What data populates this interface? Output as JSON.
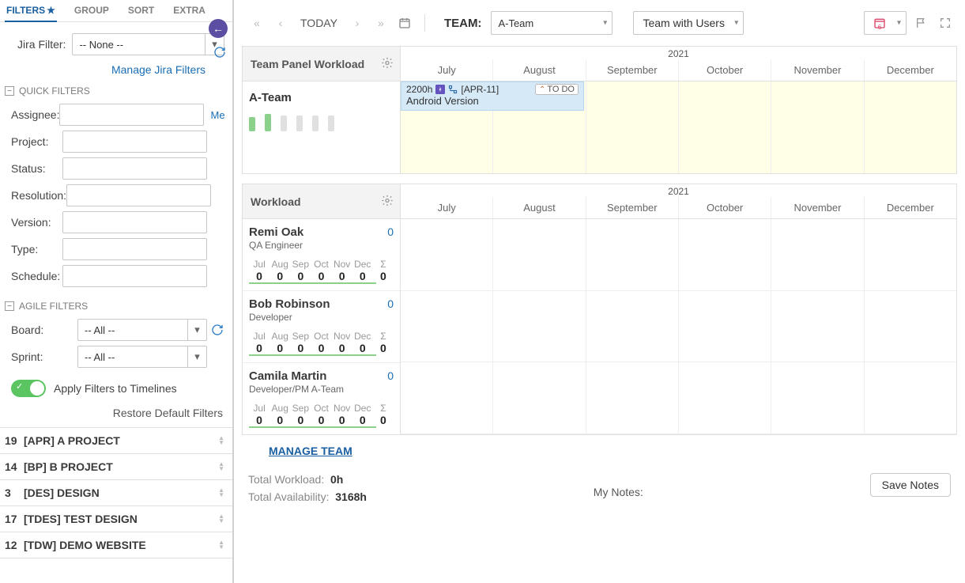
{
  "tabs": {
    "filters": "FILTERS",
    "group": "GROUP",
    "sort": "SORT",
    "extra": "EXTRA"
  },
  "sidebar": {
    "jira_label": "Jira Filter:",
    "jira_value": "-- None --",
    "manage_link": "Manage Jira Filters",
    "quick_filters_title": "QUICK FILTERS",
    "filters": {
      "assignee": "Assignee:",
      "project": "Project:",
      "status": "Status:",
      "resolution": "Resolution:",
      "version": "Version:",
      "type": "Type:",
      "schedule": "Schedule:"
    },
    "me": "Me",
    "agile_title": "AGILE FILTERS",
    "board_label": "Board:",
    "board_value": "-- All --",
    "sprint_label": "Sprint:",
    "sprint_value": "-- All --",
    "apply_label": "Apply Filters to Timelines",
    "restore_label": "Restore Default Filters",
    "projects": [
      {
        "count": "19",
        "name": "[APR] A PROJECT"
      },
      {
        "count": "14",
        "name": "[BP] B PROJECT"
      },
      {
        "count": "3",
        "name": "[DES] DESIGN"
      },
      {
        "count": "17",
        "name": "[TDES] TEST DESIGN"
      },
      {
        "count": "12",
        "name": "[TDW] DEMO WEBSITE"
      }
    ]
  },
  "toolbar": {
    "today": "TODAY",
    "team_label": "TEAM:",
    "team_value": "A-Team",
    "mode_value": "Team with Users"
  },
  "timeline": {
    "year": "2021",
    "months": [
      "July",
      "August",
      "September",
      "October",
      "November",
      "December"
    ],
    "panel_title": "Team Panel Workload",
    "team_name": "A-Team",
    "task": {
      "hours": "2200h",
      "key": "[APR-11]",
      "status": "TO DO",
      "title": "Android Version"
    }
  },
  "workload": {
    "title": "Workload",
    "months_short": [
      "Jul",
      "Aug",
      "Sep",
      "Oct",
      "Nov",
      "Dec",
      "Σ"
    ],
    "people": [
      {
        "name": "Remi Oak",
        "role": "QA Engineer",
        "count": "0",
        "vals": [
          "0",
          "0",
          "0",
          "0",
          "0",
          "0",
          "0"
        ]
      },
      {
        "name": "Bob Robinson",
        "role": "Developer",
        "count": "0",
        "vals": [
          "0",
          "0",
          "0",
          "0",
          "0",
          "0",
          "0"
        ]
      },
      {
        "name": "Camila Martin",
        "role": "Developer/PM A-Team",
        "count": "0",
        "vals": [
          "0",
          "0",
          "0",
          "0",
          "0",
          "0",
          "0"
        ]
      }
    ],
    "manage_team": "MANAGE TEAM"
  },
  "footer": {
    "total_wl_label": "Total Workload:",
    "total_wl_value": "0h",
    "total_av_label": "Total Availability:",
    "total_av_value": "3168h",
    "notes_label": "My Notes:",
    "save_label": "Save Notes"
  }
}
